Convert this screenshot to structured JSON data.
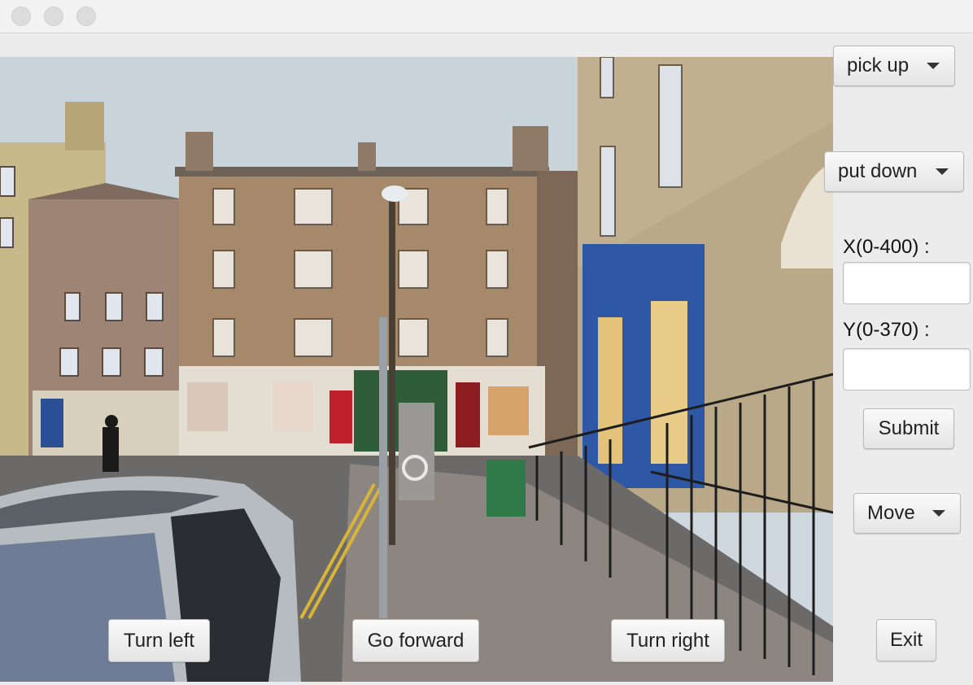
{
  "controls": {
    "pick_up": "pick up",
    "put_down": "put down",
    "x_label": "X(0-400) :",
    "x_value": "",
    "y_label": "Y(0-370) :",
    "y_value": "",
    "submit": "Submit",
    "move": "Move",
    "exit": "Exit"
  },
  "navigation": {
    "turn_left": "Turn left",
    "go_forward": "Go forward",
    "turn_right": "Turn right"
  },
  "colors": {
    "window_bg": "#ececec",
    "titlebar_bg": "#f2f2f2",
    "button_text": "#222222"
  }
}
